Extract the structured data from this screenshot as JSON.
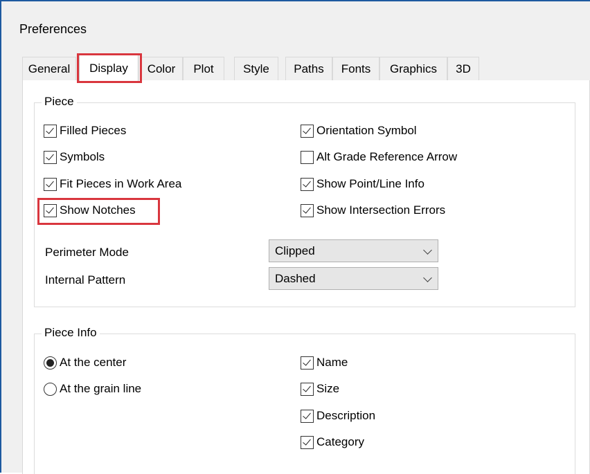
{
  "window": {
    "title": "Preferences"
  },
  "tabs": [
    {
      "label": "General",
      "active": false
    },
    {
      "label": "Display",
      "active": true
    },
    {
      "label": "Color",
      "active": false
    },
    {
      "label": "Plot",
      "active": false
    },
    {
      "label": "Style",
      "active": false
    },
    {
      "label": "Paths",
      "active": false
    },
    {
      "label": "Fonts",
      "active": false
    },
    {
      "label": "Graphics",
      "active": false
    },
    {
      "label": "3D",
      "active": false
    }
  ],
  "piece": {
    "legend": "Piece",
    "left_options": [
      {
        "label": "Filled Pieces",
        "checked": true
      },
      {
        "label": "Symbols",
        "checked": true
      },
      {
        "label": "Fit Pieces in Work Area",
        "checked": true
      },
      {
        "label": "Show Notches",
        "checked": true
      }
    ],
    "right_options": [
      {
        "label": "Orientation Symbol",
        "checked": true
      },
      {
        "label": "Alt Grade Reference Arrow",
        "checked": false
      },
      {
        "label": "Show Point/Line Info",
        "checked": true
      },
      {
        "label": "Show Intersection Errors",
        "checked": true
      }
    ],
    "perimeter_mode": {
      "label": "Perimeter Mode",
      "value": "Clipped"
    },
    "internal_pattern": {
      "label": "Internal Pattern",
      "value": "Dashed"
    }
  },
  "piece_info": {
    "legend": "Piece Info",
    "position_options": [
      {
        "label": "At the center",
        "selected": true
      },
      {
        "label": "At the grain line",
        "selected": false
      }
    ],
    "info_options": [
      {
        "label": "Name",
        "checked": true
      },
      {
        "label": "Size",
        "checked": true
      },
      {
        "label": "Description",
        "checked": true
      },
      {
        "label": "Category",
        "checked": true
      }
    ]
  },
  "highlight_color": "#d9363e"
}
